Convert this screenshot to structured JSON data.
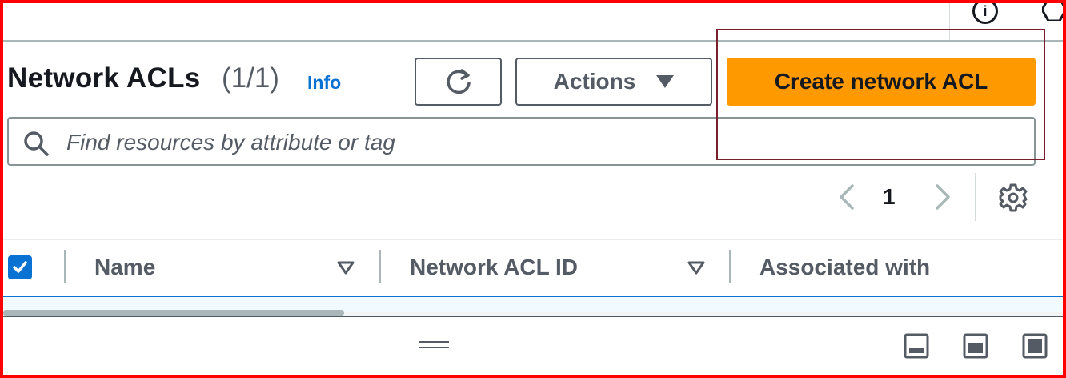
{
  "header": {
    "title": "Network ACLs",
    "count": "(1/1)",
    "info_link": "Info"
  },
  "toolbar": {
    "refresh_icon": "refresh-icon",
    "actions_label": "Actions",
    "create_label": "Create network ACL"
  },
  "search": {
    "placeholder": "Find resources by attribute or tag"
  },
  "pagination": {
    "current_page": "1"
  },
  "table": {
    "columns": [
      "Name",
      "Network ACL ID",
      "Associated with"
    ],
    "select_all_checked": true
  },
  "colors": {
    "primary_button": "#ff9900",
    "link": "#0972d3",
    "annotation_frame": "#ff0000",
    "annotation_box": "#7a1f2e"
  },
  "icons": [
    "info-icon",
    "hexagon-icon",
    "refresh-icon",
    "caret-down-icon",
    "search-icon",
    "chevron-left-icon",
    "chevron-right-icon",
    "gear-icon",
    "checkbox-checked-icon",
    "sort-caret-icon",
    "drag-handle-icon",
    "panel-bottom-icon",
    "panel-side-icon",
    "panel-full-icon"
  ]
}
